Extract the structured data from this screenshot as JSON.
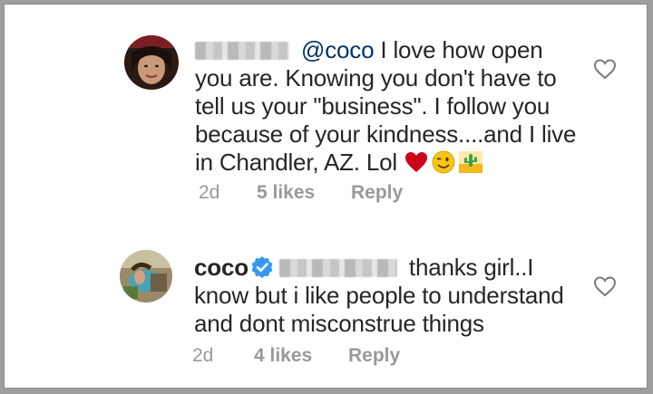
{
  "comments": [
    {
      "username": "",
      "mention": "@coco",
      "lines": [
        "I love how open",
        "you are. Knowing you don't have to",
        "tell us your \"business\". I follow you",
        "because of your kindness....and I live",
        "in Chandler, AZ. Lol"
      ],
      "emojis": [
        "red-heart",
        "winking-face",
        "desert-cactus"
      ],
      "time": "2d",
      "likes": "5 likes",
      "reply_label": "Reply"
    },
    {
      "username": "coco",
      "verified": true,
      "lines": [
        "thanks girl..I",
        "know but i  like people to understand",
        "and dont misconstrue things"
      ],
      "time": "2d",
      "likes": "4 likes",
      "reply_label": "Reply"
    }
  ],
  "colors": {
    "text": "#262626",
    "mention": "#003569",
    "meta": "#999999",
    "verified": "#3897f0",
    "heart_outline": "#7a7a7a"
  },
  "icons": [
    "like-heart-icon",
    "verified-badge-icon"
  ]
}
